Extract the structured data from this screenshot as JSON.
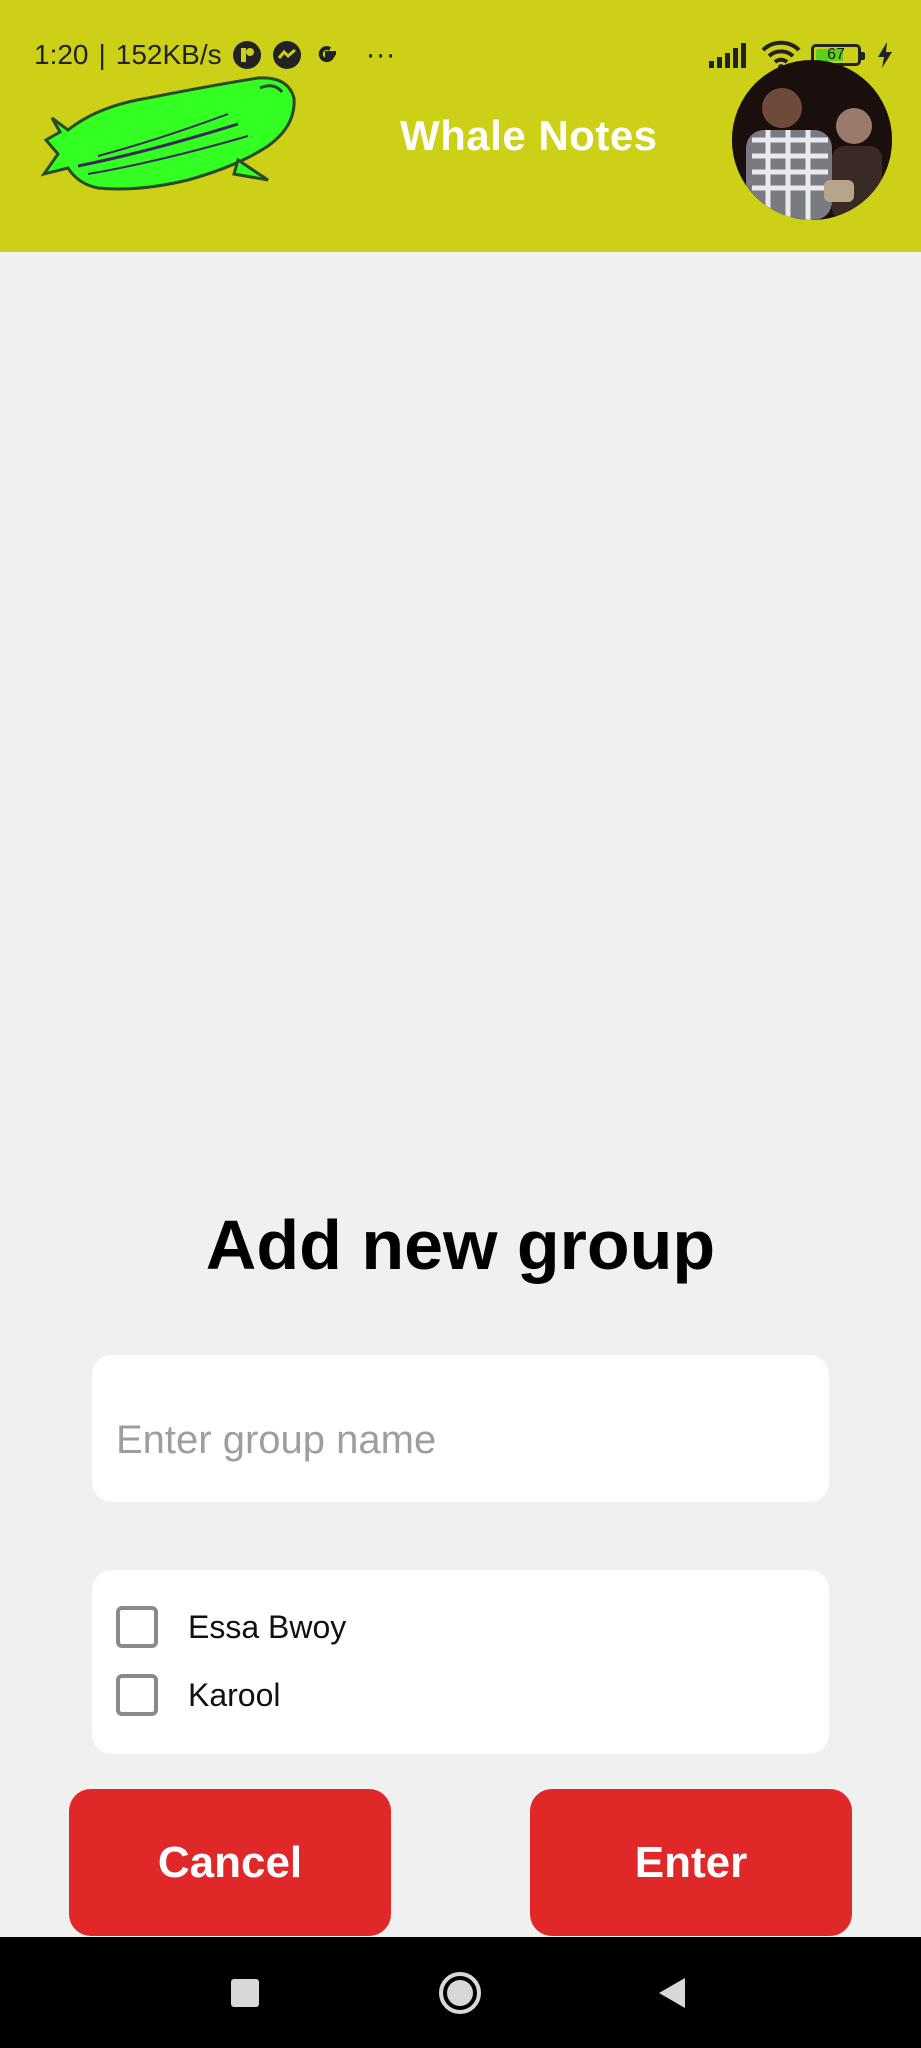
{
  "status_bar": {
    "time": "1:20",
    "separator": "|",
    "network_speed": "152KB/s",
    "notification_icons": [
      "app-notification-icon",
      "messenger-icon",
      "google-icon"
    ],
    "more": "···",
    "battery_level": 67,
    "battery_text": "67",
    "charging": true
  },
  "header": {
    "title": "Whale Notes",
    "background_color": "#ccd118",
    "logo_icon": "whale-logo",
    "avatar": "user-avatar"
  },
  "dialog": {
    "title": "Add new group",
    "group_name": {
      "value": "",
      "placeholder": "Enter group name"
    },
    "members": [
      {
        "label": "Essa Bwoy",
        "checked": false
      },
      {
        "label": "Karool",
        "checked": false
      }
    ],
    "cancel_label": "Cancel",
    "enter_label": "Enter",
    "button_color": "#e02828"
  },
  "nav_bar": {
    "recents_icon": "square-icon",
    "home_icon": "circle-icon",
    "back_icon": "triangle-back-icon"
  }
}
